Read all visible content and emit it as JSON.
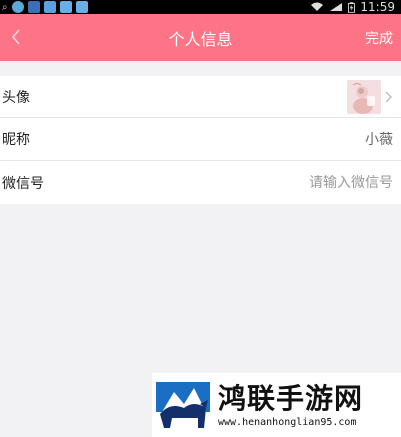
{
  "status_bar": {
    "time": "11:59",
    "icons": [
      "app-icon",
      "sina-icon",
      "paw-icon",
      "paw-icon",
      "paw-icon"
    ]
  },
  "header": {
    "title": "个人信息",
    "done_label": "完成",
    "back_icon": "chevron-left-icon",
    "background": "#fd7486"
  },
  "form": {
    "avatar_label": "头像",
    "nickname_label": "昵称",
    "nickname_value": "小薇",
    "wechat_label": "微信号",
    "wechat_placeholder": "请输入微信号"
  },
  "watermark": {
    "title": "鸿联手游网",
    "url": "www.henanhonglian95.com"
  }
}
